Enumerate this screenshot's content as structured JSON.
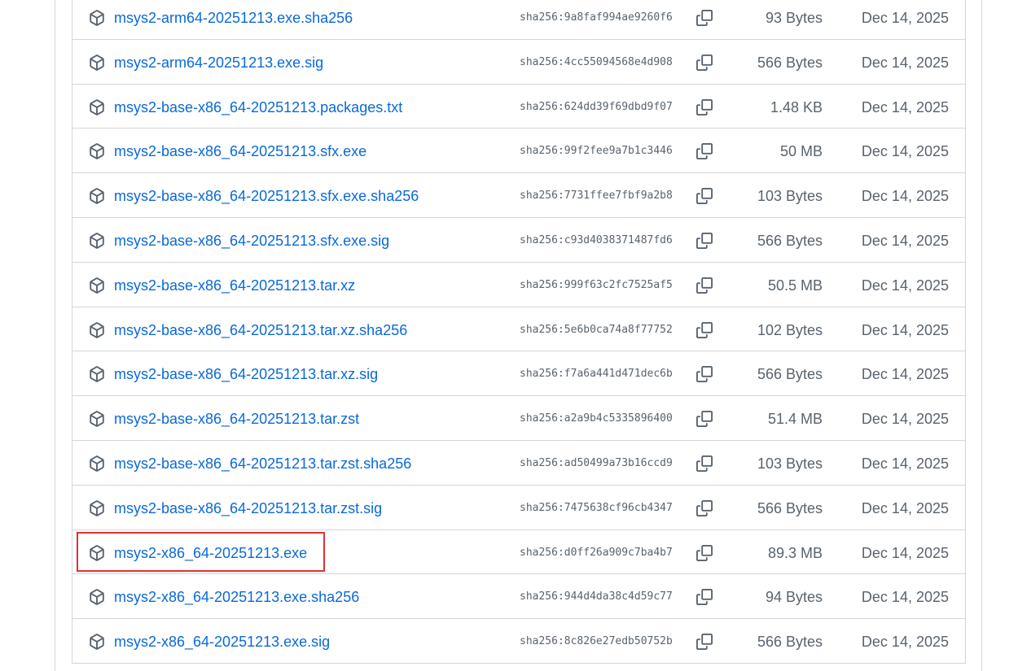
{
  "highlight_color": "#e03131",
  "link_color": "#0969da",
  "assets": [
    {
      "name": "msys2-arm64-20251213.exe.sha256",
      "digest": "sha256:9a8faf994ae9260f6",
      "size": "93 Bytes",
      "date": "Dec 14, 2025",
      "icon": "package-icon"
    },
    {
      "name": "msys2-arm64-20251213.exe.sig",
      "digest": "sha256:4cc55094568e4d908",
      "size": "566 Bytes",
      "date": "Dec 14, 2025",
      "icon": "package-icon"
    },
    {
      "name": "msys2-base-x86_64-20251213.packages.txt",
      "digest": "sha256:624dd39f69dbd9f07",
      "size": "1.48 KB",
      "date": "Dec 14, 2025",
      "icon": "package-icon"
    },
    {
      "name": "msys2-base-x86_64-20251213.sfx.exe",
      "digest": "sha256:99f2fee9a7b1c3446",
      "size": "50 MB",
      "date": "Dec 14, 2025",
      "icon": "package-icon"
    },
    {
      "name": "msys2-base-x86_64-20251213.sfx.exe.sha256",
      "digest": "sha256:7731ffee7fbf9a2b8",
      "size": "103 Bytes",
      "date": "Dec 14, 2025",
      "icon": "package-icon"
    },
    {
      "name": "msys2-base-x86_64-20251213.sfx.exe.sig",
      "digest": "sha256:c93d4038371487fd6",
      "size": "566 Bytes",
      "date": "Dec 14, 2025",
      "icon": "package-icon"
    },
    {
      "name": "msys2-base-x86_64-20251213.tar.xz",
      "digest": "sha256:999f63c2fc7525af5",
      "size": "50.5 MB",
      "date": "Dec 14, 2025",
      "icon": "package-icon"
    },
    {
      "name": "msys2-base-x86_64-20251213.tar.xz.sha256",
      "digest": "sha256:5e6b0ca74a8f77752",
      "size": "102 Bytes",
      "date": "Dec 14, 2025",
      "icon": "package-icon"
    },
    {
      "name": "msys2-base-x86_64-20251213.tar.xz.sig",
      "digest": "sha256:f7a6a441d471dec6b",
      "size": "566 Bytes",
      "date": "Dec 14, 2025",
      "icon": "package-icon"
    },
    {
      "name": "msys2-base-x86_64-20251213.tar.zst",
      "digest": "sha256:a2a9b4c5335896400",
      "size": "51.4 MB",
      "date": "Dec 14, 2025",
      "icon": "package-icon"
    },
    {
      "name": "msys2-base-x86_64-20251213.tar.zst.sha256",
      "digest": "sha256:ad50499a73b16ccd9",
      "size": "103 Bytes",
      "date": "Dec 14, 2025",
      "icon": "package-icon"
    },
    {
      "name": "msys2-base-x86_64-20251213.tar.zst.sig",
      "digest": "sha256:7475638cf96cb4347",
      "size": "566 Bytes",
      "date": "Dec 14, 2025",
      "icon": "package-icon"
    },
    {
      "name": "msys2-x86_64-20251213.exe",
      "digest": "sha256:d0ff26a909c7ba4b7",
      "size": "89.3 MB",
      "date": "Dec 14, 2025",
      "icon": "package-icon",
      "highlighted": true
    },
    {
      "name": "msys2-x86_64-20251213.exe.sha256",
      "digest": "sha256:944d4da38c4d59c77",
      "size": "94 Bytes",
      "date": "Dec 14, 2025",
      "icon": "package-icon"
    },
    {
      "name": "msys2-x86_64-20251213.exe.sig",
      "digest": "sha256:8c826e27edb50752b",
      "size": "566 Bytes",
      "date": "Dec 14, 2025",
      "icon": "package-icon"
    }
  ]
}
